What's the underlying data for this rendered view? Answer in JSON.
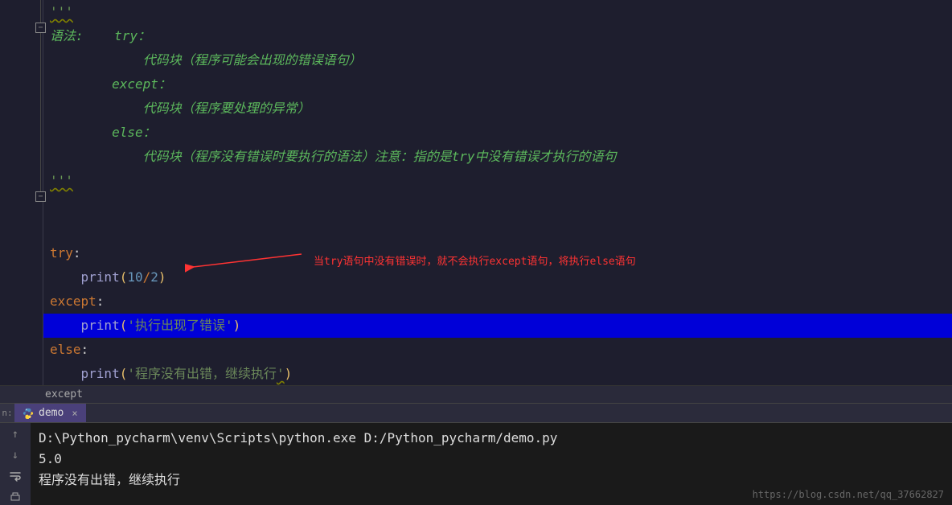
{
  "docstring": {
    "triple_open": "'''",
    "line_syntax": "语法:",
    "try_label": "try：",
    "block1": "代码块（程序可能会出现的错误语句）",
    "except_label": "except：",
    "block2": "代码块（程序要处理的异常）",
    "else_label": "else：",
    "block3": "代码块（程序没有错误时要执行的语法）注意：指的是try中没有错误才执行的语句",
    "triple_close": "'''"
  },
  "code": {
    "try_kw": "try",
    "print_fn": "print",
    "expr_a": "10",
    "expr_op": "/",
    "expr_b": "2",
    "except_kw": "except",
    "str1_open": "'",
    "str1": "执行出现了错误",
    "str1_close": "'",
    "else_kw": "else",
    "str2_open": "'",
    "str2": "程序没有出错，继续执行",
    "str2_close": "'"
  },
  "annotation": "当try语句中没有错误时，就不会执行except语句，将执行else语句",
  "breadcrumb": "except",
  "run_tab": {
    "label": "demo",
    "prefix": "n:"
  },
  "console": {
    "cmd": "D:\\Python_pycharm\\venv\\Scripts\\python.exe D:/Python_pycharm/demo.py",
    "out1": "5.0",
    "out2": "程序没有出错，继续执行"
  },
  "watermark": "https://blog.csdn.net/qq_37662827"
}
